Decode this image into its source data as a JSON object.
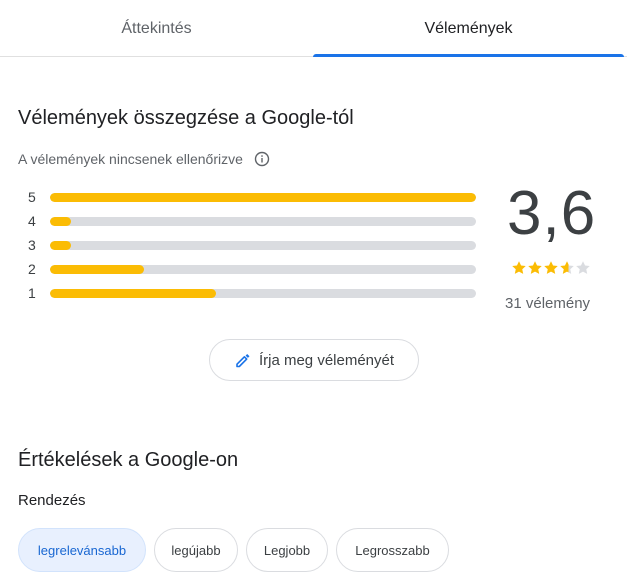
{
  "tabs": [
    {
      "label": "Áttekintés"
    },
    {
      "label": "Vélemények"
    }
  ],
  "summary": {
    "heading": "Vélemények összegzése a Google-tól",
    "unverified_note": "A vélemények nincsenek ellenőrizve",
    "distribution": [
      {
        "stars": "5",
        "fraction": 1.0
      },
      {
        "stars": "4",
        "fraction": 0.05
      },
      {
        "stars": "3",
        "fraction": 0.05
      },
      {
        "stars": "2",
        "fraction": 0.22
      },
      {
        "stars": "1",
        "fraction": 0.39
      }
    ],
    "average": "3,6",
    "star_rating": 3.6,
    "review_count": "31 vélemény"
  },
  "write_review_label": "Írja meg véleményét",
  "ratings": {
    "heading": "Értékelések a Google-on",
    "sort_label": "Rendezés",
    "sort_options": [
      {
        "label": "legrelevánsabb",
        "active": true
      },
      {
        "label": "legújabb",
        "active": false
      },
      {
        "label": "Legjobb",
        "active": false
      },
      {
        "label": "Legrosszabb",
        "active": false
      }
    ]
  },
  "colors": {
    "accent": "#1a73e8",
    "bar_fill": "#fbbc04",
    "bar_track": "#dadce0",
    "active_chip_bg": "#e8f0fe"
  },
  "icons": {
    "info": "info-icon",
    "pencil": "pencil-icon",
    "star": "star-icon"
  }
}
